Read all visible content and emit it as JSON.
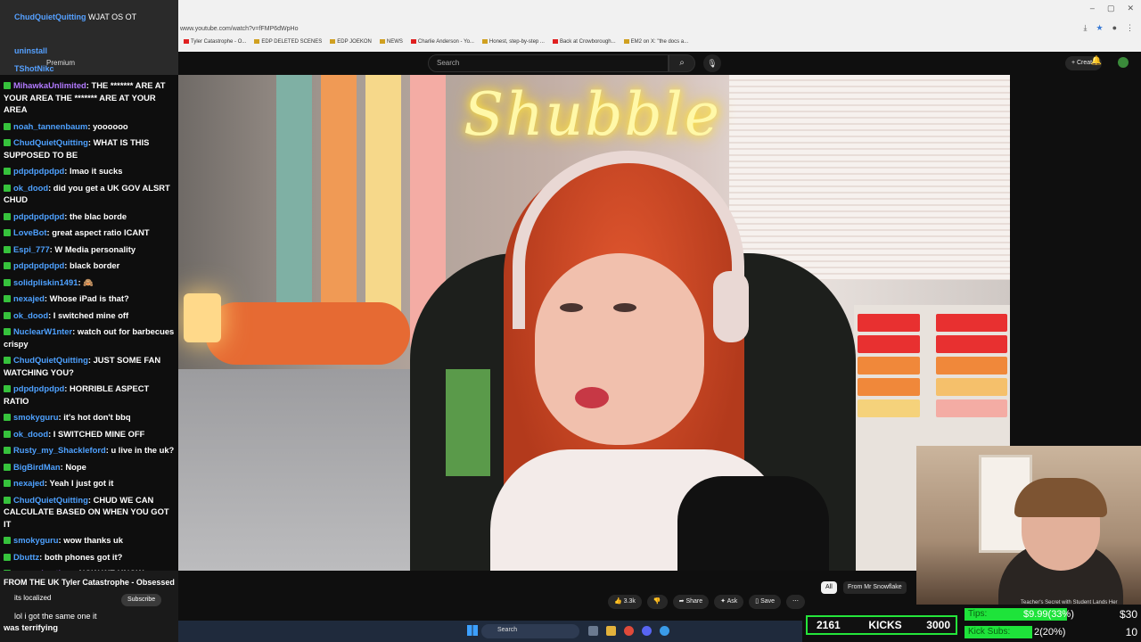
{
  "browser": {
    "url": "www.youtube.com/watch?v=fFMP6dWpHo",
    "window_controls": [
      "–",
      "▢",
      "✕"
    ],
    "bookmarks": [
      "Tyler Catastrophe - O...",
      "EDP DELETED SCENES",
      "EDP JOEKON",
      "NEWS",
      "Charlie Anderson - Yo...",
      "Honest, step-by-step ...",
      "Back at Crowborough...",
      "EM2 on X: \"the docs a..."
    ]
  },
  "youtube": {
    "search_placeholder": "Search",
    "create_label": "Create",
    "actions": {
      "likes": "3.3k",
      "share": "Share",
      "ask": "Ask",
      "save": "Save",
      "more": "⋯"
    },
    "chips": {
      "all": "All",
      "from": "From Mr Snowflake"
    },
    "video_overlay_text": "Shubble"
  },
  "chat": {
    "top_user": "ChudQuietQuitting",
    "top_message": "WJAT OS OT",
    "top_user2": "uninstall",
    "top_user3": "TShotNikc",
    "premium_label": "Premium",
    "messages": [
      {
        "user": "MihawkaUnlimited",
        "color": "purple",
        "text": "THE ******* ARE AT YOUR AREA THE ******* ARE AT YOUR AREA"
      },
      {
        "user": "noah_tannenbaum",
        "color": "blue",
        "text": "yoooooo"
      },
      {
        "user": "ChudQuietQuitting",
        "color": "blue",
        "text": "WHAT IS THIS SUPPOSED TO BE"
      },
      {
        "user": "pdpdpdpdpd",
        "color": "blue",
        "text": "lmao it sucks"
      },
      {
        "user": "ok_dood",
        "color": "blue",
        "text": "did you get a UK GOV ALSRT CHUD"
      },
      {
        "user": "pdpdpdpdpd",
        "color": "blue",
        "text": "the blac borde"
      },
      {
        "user": "LoveBot",
        "color": "blue",
        "text": "great aspect ratio ICANT"
      },
      {
        "user": "Espi_777",
        "color": "blue",
        "text": "W Media personality"
      },
      {
        "user": "pdpdpdpdpd",
        "color": "blue",
        "text": "black border"
      },
      {
        "user": "solidpliskin1491",
        "color": "blue",
        "text": "🙈"
      },
      {
        "user": "nexajed",
        "color": "blue",
        "text": "Whose iPad is that?"
      },
      {
        "user": "ok_dood",
        "color": "blue",
        "text": "I switched mine off"
      },
      {
        "user": "NuclearW1nter",
        "color": "blue",
        "text": "watch out for barbecues crispy"
      },
      {
        "user": "ChudQuietQuitting",
        "color": "blue",
        "text": "JUST SOME FAN WATCHING YOU?"
      },
      {
        "user": "pdpdpdpdpd",
        "color": "blue",
        "text": "HORRIBLE ASPECT RATIO"
      },
      {
        "user": "smokyguru",
        "color": "blue",
        "text": "it's hot don't bbq"
      },
      {
        "user": "ok_dood",
        "color": "blue",
        "text": "I SWITCHED MINE OFF"
      },
      {
        "user": "Rusty_my_Shackleford",
        "color": "blue",
        "text": "u live in the uk?"
      },
      {
        "user": "BigBirdMan",
        "color": "blue",
        "text": "Nope"
      },
      {
        "user": "nexajed",
        "color": "blue",
        "text": "Yeah I just got it"
      },
      {
        "user": "ChudQuietQuitting",
        "color": "blue",
        "text": "CHUD WE CAN CALCULATE BASED ON WHEN YOU GOT IT"
      },
      {
        "user": "smokyguru",
        "color": "blue",
        "text": "wow thanks uk"
      },
      {
        "user": "Dbuttz",
        "color": "blue",
        "text": "both phones got it?"
      },
      {
        "user": "proxyphaethon",
        "color": "purple",
        "text": "NOW WE KNOW YOURE"
      }
    ],
    "bottom_line1": "FROM THE UK",
    "bottom_channel": "Tyler Catastrophe - Obsessed",
    "bottom_line2": "its localized",
    "subscribe_label": "Subscribe",
    "bottom_line3": "lol i got the same one it",
    "last_message": "was terrifying"
  },
  "subathon": {
    "kicks_count": "2161",
    "kicks_label": "KICKS",
    "kicks_goal": "3000",
    "tips_label": "Tips:",
    "tips_value": "$9.99(33%)",
    "tips_goal": "$30",
    "tips_fraction": 0.33,
    "subs_label": "Kick Subs:",
    "subs_value": "2(20%)",
    "subs_goal": "10",
    "subs_fraction": 0.2,
    "webcam_caption": "Teacher's Secret with Student Lands Her"
  },
  "taskbar": {
    "search_placeholder": "Search"
  },
  "colors": {
    "accent_green": "#24e53a",
    "username_blue": "#4ea1ff",
    "youtube_red": "#e02020"
  }
}
